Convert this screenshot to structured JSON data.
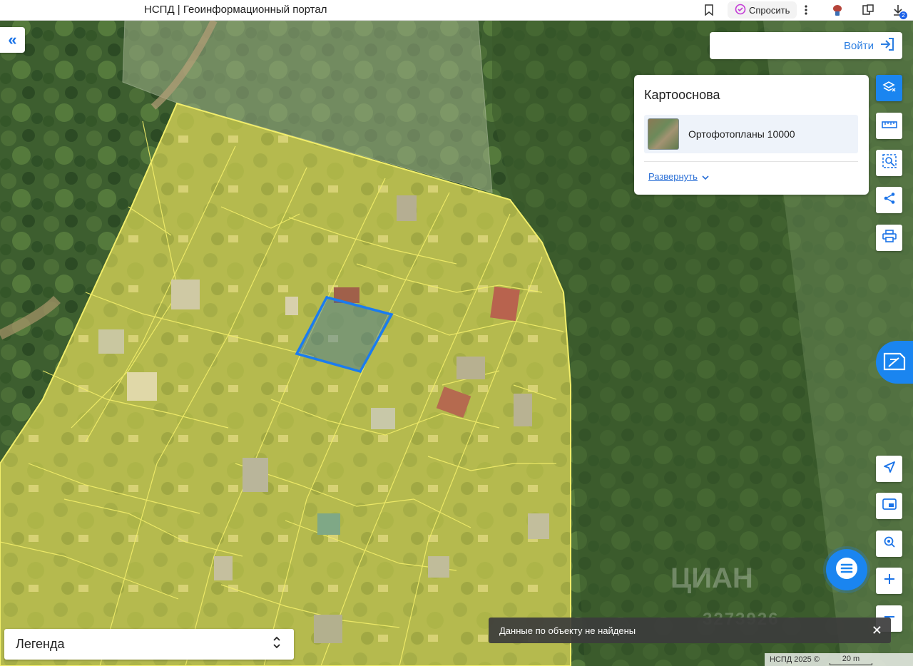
{
  "browser": {
    "tab_title": "НСПД | Геоинформационный портал",
    "ask_label": "Спросить",
    "download_count": "2",
    "icons": [
      "bookmark-icon",
      "spark-icon",
      "more-icon",
      "extension-icon",
      "collections-icon",
      "download-icon"
    ]
  },
  "map": {
    "login_label": "Войти",
    "basemap_panel": {
      "title": "Картооснова",
      "layer_label": "Ортофотопланы 10000",
      "expand_label": "Развернуть"
    },
    "legend_label": "Легенда",
    "toast_text": "Данные по объекту не найдены",
    "copyright": "НСПД 2025 ©",
    "scale_label": "20 m",
    "watermark": "ЦИАН",
    "watermark_number": "3273926",
    "tools": [
      "layers-clear-icon",
      "ruler-icon",
      "area-select-icon",
      "share-icon",
      "print-icon"
    ],
    "controls": [
      "locate-icon",
      "picture-in-picture-icon",
      "geo-search-icon",
      "zoom-in-icon",
      "zoom-out-icon"
    ],
    "colors": {
      "accent": "#1a85f0",
      "parcel_fill": "#e8e24a",
      "parcel_line": "#f2ee6a",
      "selected_parcel": "#1a7cf0"
    }
  }
}
